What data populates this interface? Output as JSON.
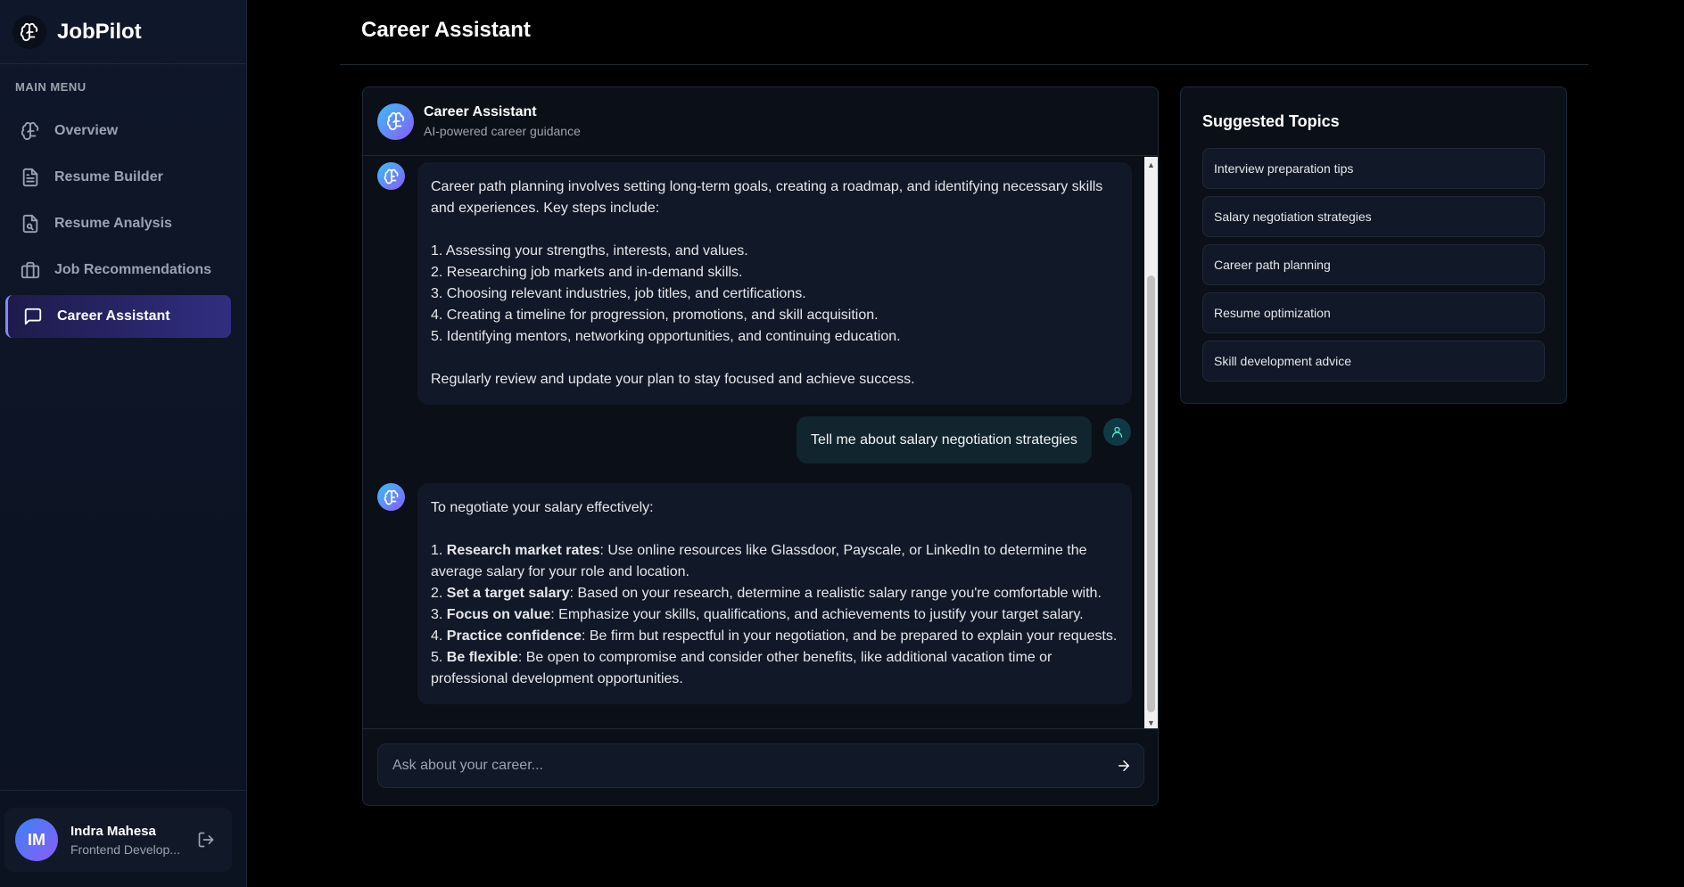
{
  "app": {
    "name": "JobPilot"
  },
  "sidebar": {
    "menu_title": "MAIN MENU",
    "items": [
      {
        "label": "Overview",
        "icon": "brain-icon",
        "active": false
      },
      {
        "label": "Resume Builder",
        "icon": "document-icon",
        "active": false
      },
      {
        "label": "Resume Analysis",
        "icon": "file-search-icon",
        "active": false
      },
      {
        "label": "Job Recommendations",
        "icon": "briefcase-icon",
        "active": false
      },
      {
        "label": "Career Assistant",
        "icon": "chat-icon",
        "active": true
      }
    ],
    "user": {
      "initials": "IM",
      "name": "Indra Mahesa",
      "role": "Frontend Develop..."
    }
  },
  "header": {
    "title": "Career Assistant"
  },
  "chat": {
    "title": "Career Assistant",
    "subtitle": "AI-powered career guidance",
    "messages": [
      {
        "role": "assistant",
        "intro": "Career path planning involves setting long-term goals, creating a roadmap, and identifying necessary skills and experiences. Key steps include:",
        "steps": [
          "1. Assessing your strengths, interests, and values.",
          "2. Researching job markets and in-demand skills.",
          "3. Choosing relevant industries, job titles, and certifications.",
          "4. Creating a timeline for progression, promotions, and skill acquisition.",
          "5. Identifying mentors, networking opportunities, and continuing education."
        ],
        "outro": "Regularly review and update your plan to stay focused and achieve success."
      },
      {
        "role": "user",
        "text": "Tell me about salary negotiation strategies"
      },
      {
        "role": "assistant",
        "intro": "To negotiate your salary effectively:",
        "steps": [
          {
            "num": "1. ",
            "bold": "Research market rates",
            "rest": ": Use online resources like Glassdoor, Payscale, or LinkedIn to determine the average salary for your role and location."
          },
          {
            "num": "2. ",
            "bold": "Set a target salary",
            "rest": ": Based on your research, determine a realistic salary range you're comfortable with."
          },
          {
            "num": "3. ",
            "bold": "Focus on value",
            "rest": ": Emphasize your skills, qualifications, and achievements to justify your target salary."
          },
          {
            "num": "4. ",
            "bold": "Practice confidence",
            "rest": ": Be firm but respectful in your negotiation, and be prepared to explain your requests."
          },
          {
            "num": "5. ",
            "bold": "Be flexible",
            "rest": ": Be open to compromise and consider other benefits, like additional vacation time or professional development opportunities."
          }
        ]
      }
    ],
    "input_placeholder": "Ask about your career..."
  },
  "topics": {
    "title": "Suggested Topics",
    "items": [
      "Interview preparation tips",
      "Salary negotiation strategies",
      "Career path planning",
      "Resume optimization",
      "Skill development advice"
    ]
  },
  "colors": {
    "background": "#000000",
    "sidebar": "#0f172a",
    "panel": "#0b0f17",
    "bubble": "#111827",
    "user_bubble": "#10252e",
    "active_item": "#312e81",
    "accent": "#818cf8"
  }
}
